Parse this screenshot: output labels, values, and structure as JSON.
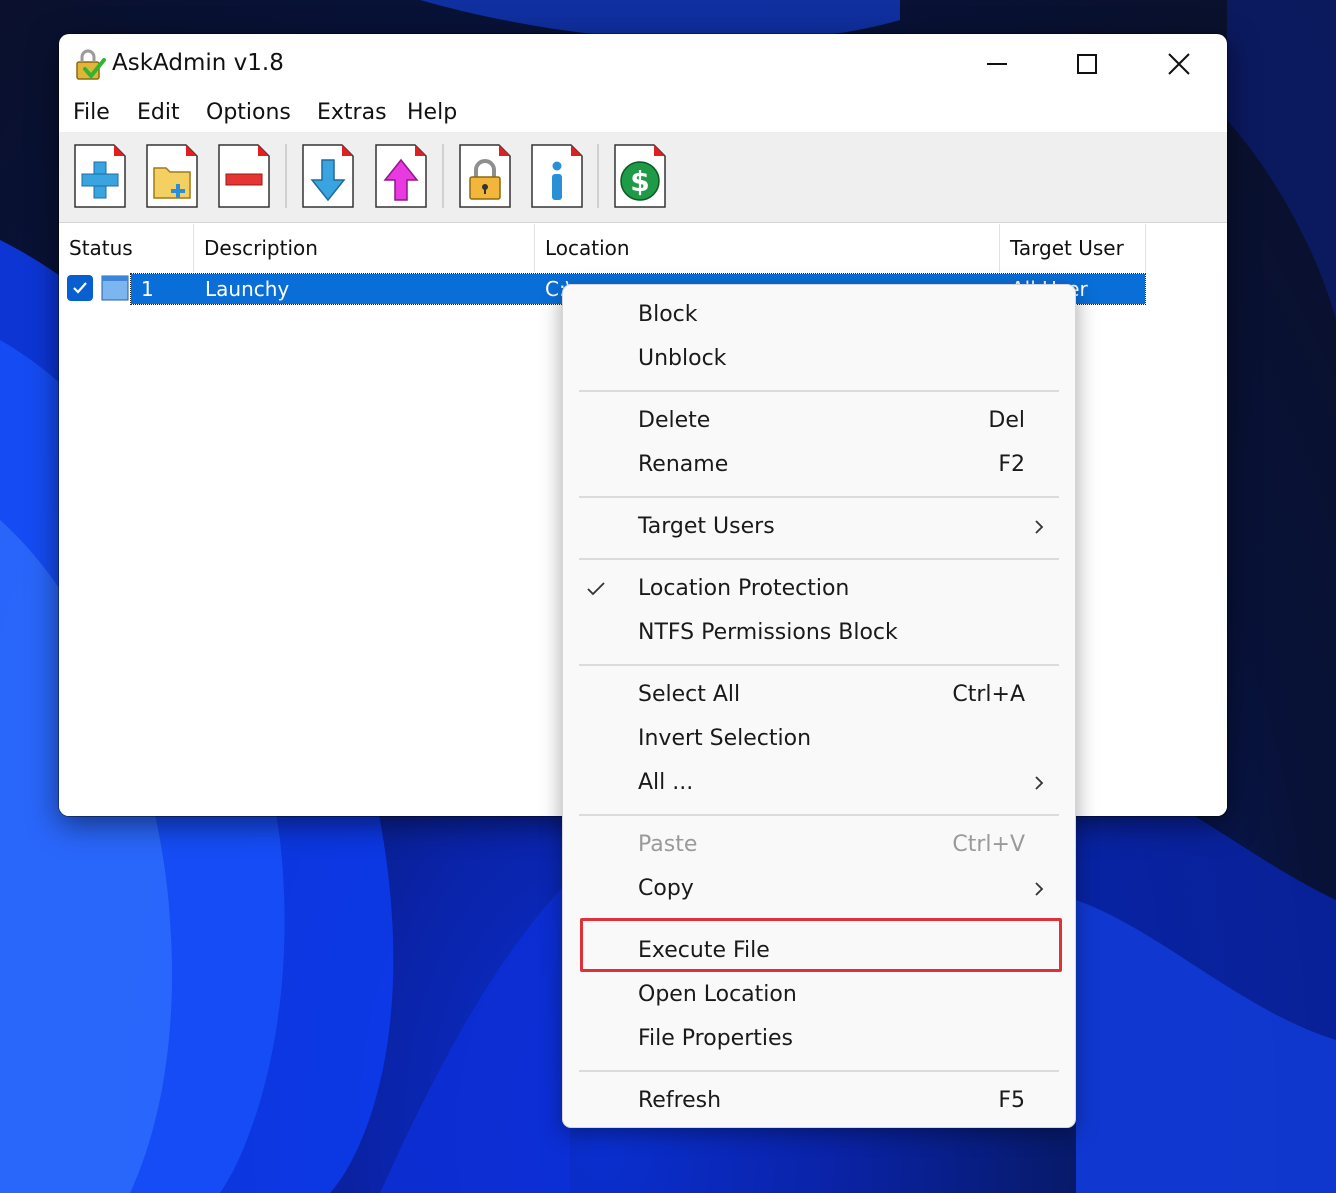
{
  "window": {
    "title": "AskAdmin v1.8"
  },
  "menubar": {
    "items": [
      "File",
      "Edit",
      "Options",
      "Extras",
      "Help"
    ]
  },
  "toolbar": {
    "buttons": [
      {
        "name": "add-file",
        "icon": "plus-icon"
      },
      {
        "name": "add-folder",
        "icon": "folder-add-icon"
      },
      {
        "name": "remove",
        "icon": "minus-icon"
      },
      {
        "name": "import",
        "icon": "arrow-down-icon"
      },
      {
        "name": "export",
        "icon": "arrow-up-icon"
      },
      {
        "name": "lock",
        "icon": "padlock-icon"
      },
      {
        "name": "info",
        "icon": "info-icon"
      },
      {
        "name": "donate",
        "icon": "dollar-icon"
      }
    ]
  },
  "list": {
    "columns": [
      "Status",
      "Description",
      "Location",
      "Target User"
    ],
    "rows": [
      {
        "number": "1",
        "description": "Launchy",
        "location": "C:\\...\\launchy.exe",
        "target_user": "All User",
        "location_visible": "C:\\",
        "target_visible": "All User"
      }
    ]
  },
  "context_menu": {
    "groups": [
      [
        {
          "label": "Block",
          "shortcut": ""
        },
        {
          "label": "Unblock",
          "shortcut": ""
        }
      ],
      [
        {
          "label": "Delete",
          "shortcut": "Del"
        },
        {
          "label": "Rename",
          "shortcut": "F2"
        }
      ],
      [
        {
          "label": "Target Users",
          "shortcut": "",
          "submenu": true
        }
      ],
      [
        {
          "label": "Location Protection",
          "shortcut": "",
          "checked": true
        },
        {
          "label": "NTFS Permissions Block",
          "shortcut": ""
        }
      ],
      [
        {
          "label": "Select All",
          "shortcut": "Ctrl+A"
        },
        {
          "label": "Invert Selection",
          "shortcut": ""
        },
        {
          "label": "All ...",
          "shortcut": "",
          "submenu": true
        }
      ],
      [
        {
          "label": "Paste",
          "shortcut": "Ctrl+V",
          "disabled": true
        },
        {
          "label": "Copy",
          "shortcut": "",
          "submenu": true
        }
      ],
      [
        {
          "label": "Execute File",
          "shortcut": "",
          "highlighted": true
        },
        {
          "label": "Open Location",
          "shortcut": ""
        },
        {
          "label": "File Properties",
          "shortcut": ""
        }
      ],
      [
        {
          "label": "Refresh",
          "shortcut": "F5"
        }
      ]
    ]
  },
  "colors": {
    "selection": "#0a6ed8",
    "highlight_border": "#e0303a",
    "accent": "#0a5fd0"
  }
}
